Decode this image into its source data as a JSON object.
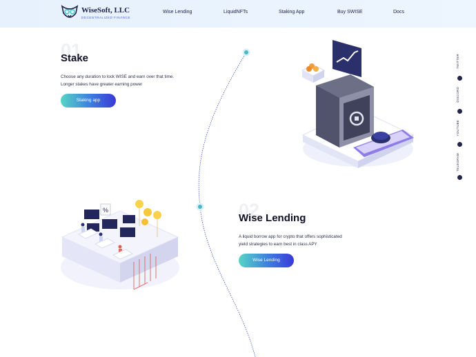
{
  "header": {
    "brand_name": "WiseSoft, LLC",
    "brand_tagline": "DECENTRALIZED FINANCE",
    "nav": [
      {
        "label": "Wise Lending"
      },
      {
        "label": "LiquidNFTs"
      },
      {
        "label": "Staking App"
      },
      {
        "label": "Buy SWISE"
      },
      {
        "label": "Docs"
      }
    ]
  },
  "sections": {
    "stake": {
      "number": "01",
      "title": "Stake",
      "description_line1": "Choose any duration to lock WISE and earn over that time.",
      "description_line2": "Longer stakes have greater earning power",
      "button": "Staking app"
    },
    "lending": {
      "number": "02",
      "title": "Wise Lending",
      "description_line1": "A liquid borrow app for crypto that offers sophisticated",
      "description_line2": "yield strategies to earn best in class APY",
      "button": "Wise Lending"
    }
  },
  "social": {
    "items": [
      {
        "label": "TWITTER",
        "icon": "twitter-icon"
      },
      {
        "label": "DISCORD",
        "icon": "discord-icon"
      },
      {
        "label": "YOUTUBE",
        "icon": "youtube-icon"
      },
      {
        "label": "TELEGRAM",
        "icon": "telegram-icon"
      }
    ]
  },
  "colors": {
    "accent_start": "#55d6c4",
    "accent_mid": "#3d7ce0",
    "accent_end": "#3a3ad6",
    "header_bg": "#e6f1fd",
    "timeline_dot": "#4bb7c9"
  }
}
